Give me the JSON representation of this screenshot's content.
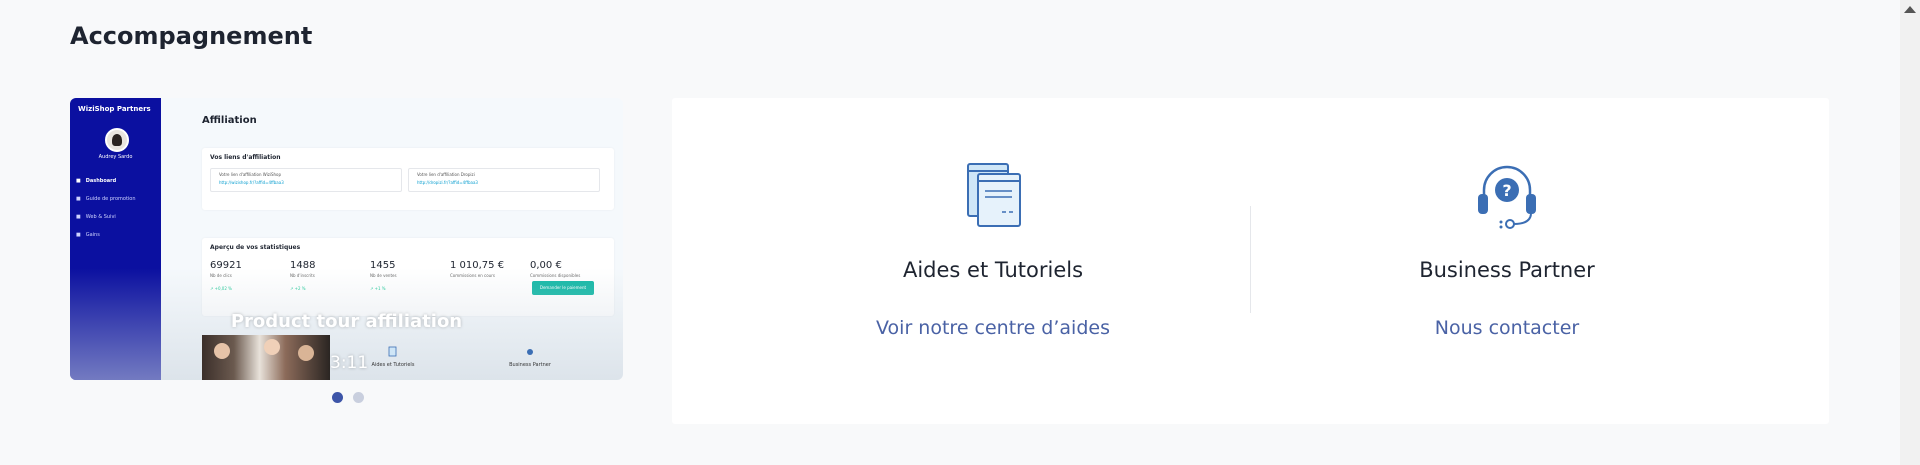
{
  "section": {
    "title": "Accompagnement"
  },
  "video": {
    "label": "Product tour affiliation",
    "duration": "3:11",
    "app": {
      "brand": "WiziShop Partners",
      "user": "Audrey Sardo",
      "nav": [
        "Dashboard",
        "Guide de promotion",
        "Web & Suivi",
        "Gains"
      ],
      "page_title": "Affiliation",
      "links_panel_title": "Vos liens d'affiliation",
      "link1_label": "Votre lien d'affiliation WiziShop",
      "link1_url": "http://wizishop.fr/?affid=4ffbaa3",
      "link2_label": "Votre lien d'affiliation Dropizi",
      "link2_url": "http://dropizi.fr/?affid=4ffbaa3",
      "stats_panel_title": "Aperçu de vos statistiques",
      "stats": [
        {
          "value": "69921",
          "label": "Nb de clics",
          "delta": "↗ +0,02 %"
        },
        {
          "value": "1488",
          "label": "Nb d'inscrits",
          "delta": "↗ +2 %"
        },
        {
          "value": "1455",
          "label": "Nb de ventes",
          "delta": "↗ +1 %"
        },
        {
          "value": "1 010,75 €",
          "label": "Commissions en cours",
          "delta": ""
        },
        {
          "value": "0,00 €",
          "label": "Commissions disponibles",
          "delta": ""
        }
      ],
      "cta": "Demander le paiement",
      "mini_items": [
        "Aides et Tutoriels",
        "Business Partner"
      ]
    },
    "carousel": {
      "count": 2,
      "active_index": 1
    }
  },
  "help": {
    "items": [
      {
        "title": "Aides et Tutoriels",
        "link": "Voir notre centre d’aides",
        "icon": "documents-icon"
      },
      {
        "title": "Business Partner",
        "link": "Nous contacter",
        "icon": "headset-help-icon"
      }
    ]
  },
  "colors": {
    "accent": "#4a62a5",
    "icon_light": "#cfe6f7",
    "icon_stroke": "#3b6eb4",
    "dot_active": "#3d55a8",
    "dot_inactive": "#c9cfde",
    "video_sidebar": "#0b10a0"
  }
}
